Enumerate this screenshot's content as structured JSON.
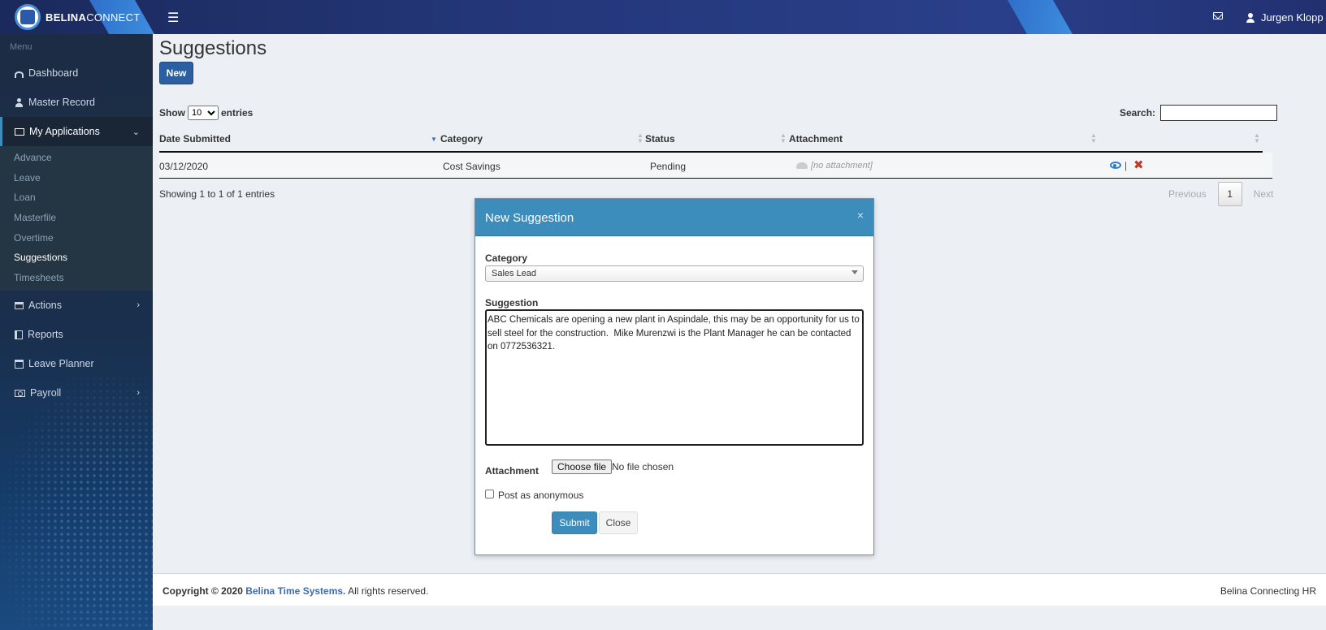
{
  "header": {
    "logo_bold": "BELINA",
    "logo_thin": "CONNECT",
    "user_name": "Jurgen Klopp"
  },
  "sidebar": {
    "menu_label": "Menu",
    "items": [
      {
        "label": "Dashboard"
      },
      {
        "label": "Master Record"
      },
      {
        "label": "My Applications"
      },
      {
        "label": "Actions"
      },
      {
        "label": "Reports"
      },
      {
        "label": "Leave Planner"
      },
      {
        "label": "Payroll"
      }
    ],
    "submenu": [
      "Advance",
      "Leave",
      "Loan",
      "Masterfile",
      "Overtime",
      "Suggestions",
      "Timesheets"
    ]
  },
  "main": {
    "title": "Suggestions",
    "new_label": "New",
    "show_label": "Show",
    "entries_value": "10",
    "entries_label": "entries",
    "search_label": "Search:",
    "columns": [
      "Date Submitted",
      "Category",
      "Status",
      "Attachment"
    ],
    "rows": [
      {
        "date": "03/12/2020",
        "category": "Cost Savings",
        "status": "Pending",
        "attachment": "[no attachment]"
      }
    ],
    "info": "Showing 1 to 1 of 1 entries",
    "paging": {
      "previous": "Previous",
      "current": "1",
      "next": "Next"
    }
  },
  "modal": {
    "title": "New Suggestion",
    "close_x": "×",
    "category_label": "Category",
    "category_value": "Sales Lead",
    "suggestion_label": "Suggestion",
    "suggestion_text": "ABC Chemicals are opening a new plant in Aspindale, this may be an opportunity for us to sell steel for the construction.  Mike Murenzwi is the Plant Manager he can be contacted on 0772536321.",
    "attachment_label": "Attachment",
    "file_button": "Choose file",
    "file_status": "No file chosen",
    "anonymous_label": "Post as anonymous",
    "submit_label": "Submit",
    "close_label": "Close"
  },
  "footer": {
    "copyright": "Copyright © 2020",
    "company": "Belina Time Systems.",
    "rights": "All rights reserved.",
    "tagline": "Belina Connecting HR"
  },
  "colors": {
    "primary": "#3c8dbc",
    "new_button": "#2b5fa0",
    "delete": "#c0392b"
  }
}
